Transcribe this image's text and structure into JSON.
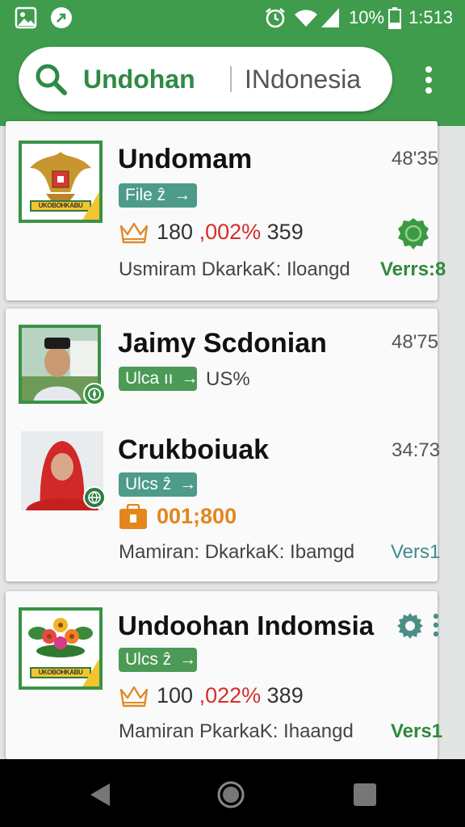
{
  "status_bar": {
    "battery_pct": "10%",
    "time": "1:513",
    "icons": [
      "gallery-icon",
      "signal-arrow-icon",
      "alarm-icon",
      "wifi-icon",
      "cell-signal-icon",
      "battery-icon"
    ]
  },
  "header": {
    "search_term": "Undohan",
    "search_location": "INdonesia",
    "icons": [
      "search-icon",
      "overflow-menu-icon"
    ]
  },
  "colors": {
    "primary_green": "#3e9c4c",
    "chip_teal": "#4d9b8a",
    "chip_green": "#4b9a55",
    "red": "#d62c2c",
    "orange": "#e3861c"
  },
  "cards": [
    {
      "name": "Undomam",
      "time": "48'35",
      "chip": "File ẑ",
      "chip_arrow": "→",
      "stats_num": "180",
      "stats_red": ",002%",
      "stats_tail": "359",
      "meta": "Usmiram DkarkaK: Iloangd",
      "version": "Verrs:8",
      "banner": "UKOBOHKABU",
      "icons": [
        "garuda-emblem-icon",
        "crown-icon",
        "award-seal-icon"
      ]
    },
    {
      "entries": [
        {
          "name": "Jaimy Scdonian",
          "time": "48'75",
          "chip": "Ulca ıı",
          "chip_arrow": "→",
          "after_chip": "US%",
          "icons": [
            "avatar-photo",
            "compass-badge-icon"
          ]
        },
        {
          "name": "Crukboiuak",
          "time": "34:73",
          "chip": "Ulcs ẑ",
          "chip_arrow": "→",
          "stats": "001;800",
          "meta": "Mamiran: DkarkaK: Ibamgd",
          "version": "Vers1",
          "icons": [
            "avatar-photo",
            "globe-badge-icon",
            "wallet-icon"
          ]
        }
      ]
    },
    {
      "name": "Undoohan Indomsia",
      "chip": "Ulcs ẑ",
      "chip_arrow": "→",
      "stats_num": "100",
      "stats_red": ",022%",
      "stats_tail": "389",
      "meta": "Mamiran PkarkaK: Ihaangd",
      "version": "Vers1",
      "banner": "UKOBOHKABU",
      "icons": [
        "flower-emblem-icon",
        "crown-icon",
        "gear-icon",
        "overflow-menu-icon"
      ]
    }
  ]
}
